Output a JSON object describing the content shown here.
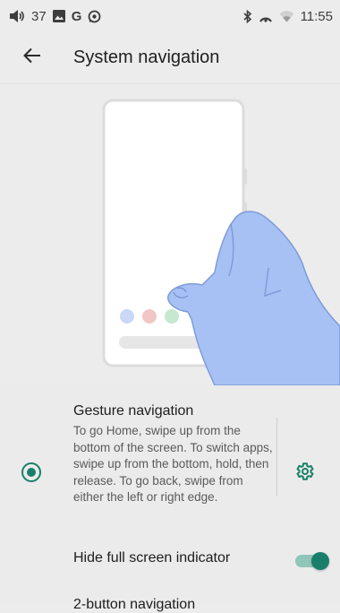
{
  "status_bar": {
    "volume_level": "37",
    "carrier_glyph": "G",
    "time": "11:55",
    "icons": [
      "volume-icon",
      "image-icon",
      "g-icon",
      "whatsapp-icon",
      "bluetooth-icon",
      "hotspot-icon",
      "wifi-icon"
    ]
  },
  "app_bar": {
    "title": "System navigation",
    "back_icon": "arrow-back-icon"
  },
  "illustration": {
    "phone_color": "#ffffff",
    "hand_color": "#a8c1f5",
    "dots": [
      "#c9d8f7",
      "#f3c6c6",
      "#c6e7d0",
      "#f3c6c6"
    ]
  },
  "options": {
    "gesture": {
      "title": "Gesture navigation",
      "description": "To go Home, swipe up from the bottom of the screen. To switch apps, swipe up from the bottom, hold, then release. To go back, swipe from either the left or right edge.",
      "selected": true,
      "settings_icon": "gear-icon"
    },
    "hide_indicator": {
      "label": "Hide full screen indicator",
      "enabled": true
    },
    "partial_next": {
      "label": "2-button navigation"
    }
  },
  "colors": {
    "accent": "#1a7f6a",
    "background": "#ececec"
  }
}
